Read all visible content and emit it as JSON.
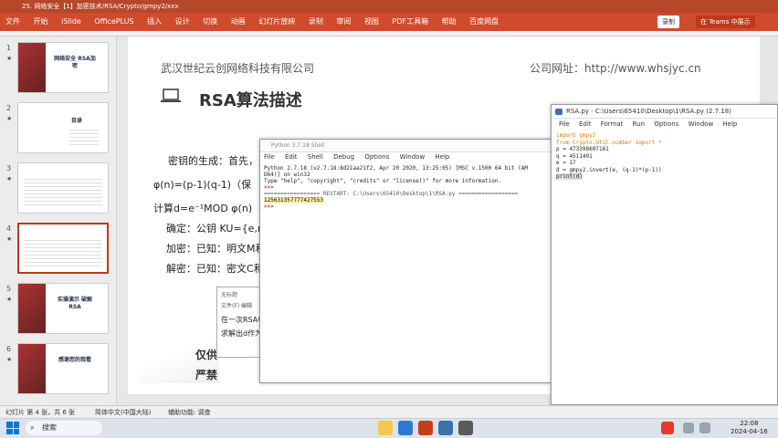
{
  "titlebar": {
    "text": "25. 网络安全【1】加密技术/RSA/Crypto/gmpy2/xxx"
  },
  "ribbon": {
    "tabs": [
      "文件",
      "开始",
      "iSlide",
      "OfficePLUS",
      "插入",
      "设计",
      "切换",
      "动画",
      "幻灯片放映",
      "录制",
      "审阅",
      "视图",
      "PDF工具箱",
      "帮助",
      "百度网盘"
    ],
    "share": "录制",
    "teams": "在 Teams 中展示"
  },
  "thumbnails": [
    {
      "num": "1",
      "title": "网络安全 RSA加密"
    },
    {
      "num": "2",
      "title": "目录"
    },
    {
      "num": "3",
      "title": ""
    },
    {
      "num": "4",
      "title": ""
    },
    {
      "num": "5",
      "title": "实操演示 破解RSA"
    },
    {
      "num": "6",
      "title": "感谢您的观看"
    }
  ],
  "slide": {
    "company": "武汉世纪云创网络科技有限公司",
    "website": "公司网址：http://www.whsjyc.cn",
    "title": "RSA算法描述",
    "lines": [
      "密钥的生成：首先，选",
      "φ(n)=(p-1)(q-1)（保",
      "计算d=e⁻¹MOD φ(n)（",
      "确定：公钥 KU={e,n",
      "加密：已知：明文M和",
      "解密：已知：密文C和"
    ],
    "bottom1": "仅供",
    "bottom2": "严禁"
  },
  "shell": {
    "title": "Python 3.7.18 Shell",
    "menu": [
      "File",
      "Edit",
      "Shell",
      "Debug",
      "Options",
      "Window",
      "Help"
    ],
    "line1": "Python 2.7.18 (v2.7.18:8d21aa21f2, Apr 20 2020, 13:25:05) [MSC v.1500 64 bit (AM",
    "line2": "D64)] on win32",
    "line3": "Type \"help\", \"copyright\", \"credits\" or \"license()\" for more information.",
    "line4": ">>> ",
    "line5": "================= RESTART: C:\\Users\\65410\\Desktop\\1\\RSA.py ==================",
    "output": "125631357777427553",
    "line7": ">>> "
  },
  "editor": {
    "title": "RSA.py - C:\\Users\\65410\\Desktop\\1\\RSA.py (2.7.18)",
    "menu": [
      "File",
      "Edit",
      "Format",
      "Run",
      "Options",
      "Window",
      "Help"
    ],
    "code": [
      "import gmpy2",
      "from Crypto.Util.number import *",
      "",
      "p = 473398607161",
      "q = 4511491",
      "e = 17",
      "",
      "d = gmpy2.invert(e, (q-1)*(p-1))",
      "",
      "print(d)"
    ]
  },
  "notepad": {
    "title": "无标题",
    "menu": "文件(F) 编辑",
    "line1": "在一次RSA中",
    "line2": "求解出d作为"
  },
  "statusbar": {
    "slide_info": "幻灯片 第 4 张，共 6 张",
    "lang": "简体中文(中国大陆)",
    "access": "辅助功能: 调查"
  },
  "taskbar": {
    "search": "搜索",
    "time": "22:08",
    "date": "2024-04-16"
  }
}
